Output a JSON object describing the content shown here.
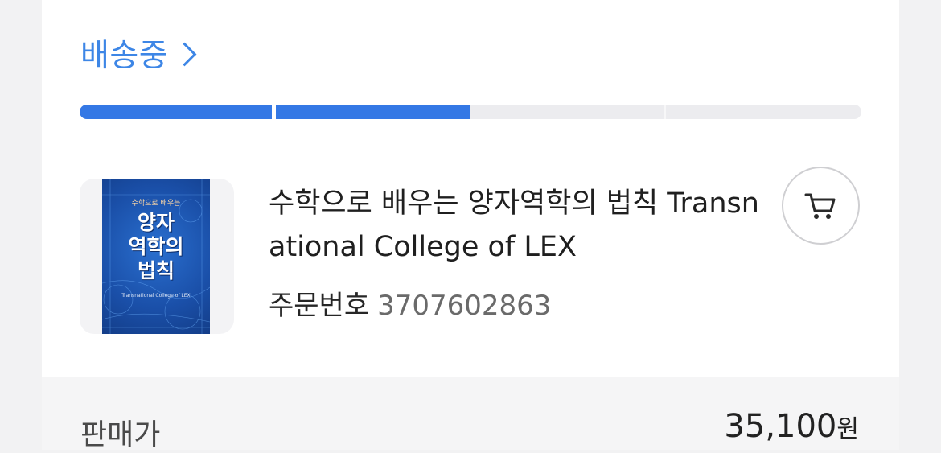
{
  "delivery": {
    "status_label": "배송중",
    "progress": {
      "completed_steps": 2,
      "total_steps": 4,
      "active_color": "#3478e5"
    }
  },
  "product": {
    "cover": {
      "subtitle": "수학으로 배우는",
      "title_line1": "양자",
      "title_line2": "역학의",
      "title_line3": "법칙",
      "author_line": "Transnational College of LEX"
    },
    "title": "수학으로 배우는 양자역학의 법칙 Transnational College of LEX",
    "order_label": "주문번호",
    "order_number": "3707602863"
  },
  "actions": {
    "cart_icon": "cart-icon"
  },
  "price": {
    "label": "판매가",
    "value": "35,100",
    "unit": "원"
  }
}
